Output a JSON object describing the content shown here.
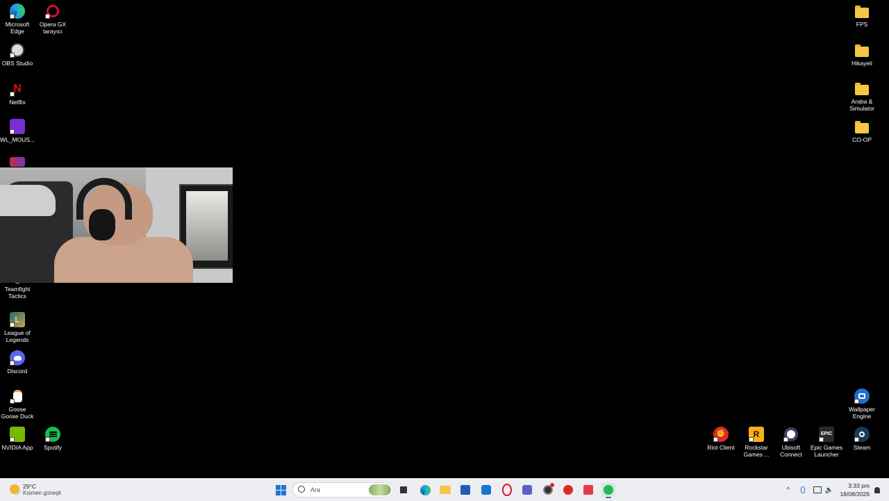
{
  "desktop": {
    "left_icons": [
      {
        "label": "Microsoft Edge",
        "icon": "edge-icon"
      },
      {
        "label": "Opera GX tarayıcı",
        "icon": "opera-gx-icon"
      },
      {
        "label": "OBS Studio",
        "icon": "obs-icon"
      },
      {
        "label": "Netflix",
        "icon": "netflix-icon"
      },
      {
        "label": "WL_MOUS...",
        "icon": "mouse-app-icon"
      },
      {
        "label": "Teamfight Tactics",
        "icon": "tft-icon"
      },
      {
        "label": "League of Legends",
        "icon": "league-icon"
      },
      {
        "label": "Discord",
        "icon": "discord-icon"
      },
      {
        "label": "Goose Goose Duck",
        "icon": "goose-icon"
      },
      {
        "label": "NVIDIA App",
        "icon": "nvidia-icon"
      },
      {
        "label": "Spotify",
        "icon": "spotify-icon"
      }
    ],
    "right_icons": [
      {
        "label": "FPS",
        "icon": "folder-icon"
      },
      {
        "label": "Hikayeli",
        "icon": "folder-icon"
      },
      {
        "label": "Araba & Simulator",
        "icon": "folder-icon"
      },
      {
        "label": "CO-OP",
        "icon": "folder-icon"
      },
      {
        "label": "Wallpaper Engine",
        "icon": "wallpaper-engine-icon"
      },
      {
        "label": "Riot Client",
        "icon": "riot-icon"
      },
      {
        "label": "Rockstar Games ...",
        "icon": "rockstar-icon"
      },
      {
        "label": "Ubisoft Connect",
        "icon": "ubisoft-icon"
      },
      {
        "label": "Epic Games Launcher",
        "icon": "epic-icon"
      },
      {
        "label": "Steam",
        "icon": "steam-icon"
      }
    ],
    "webcam_overlay": "webcam-feed"
  },
  "taskbar": {
    "weather": {
      "temp": "29°C",
      "condition": "Kısmen güneşli"
    },
    "search_placeholder": "Ara",
    "pinned": [
      "start-icon",
      "search-icon",
      "task-view-icon",
      "edge-icon",
      "file-explorer-icon",
      "store-icon",
      "outlook-icon",
      "opera-gx-icon",
      "teams-icon",
      "obs-icon",
      "riot-icon",
      "valorant-icon",
      "spotify-icon"
    ],
    "tray": {
      "time": "3:33 pm",
      "date": "18/08/2026"
    },
    "colors": {
      "start": "#1f76d2",
      "spotify": "#1db954",
      "opera": "#d8102f",
      "riot": "#e02828"
    }
  }
}
